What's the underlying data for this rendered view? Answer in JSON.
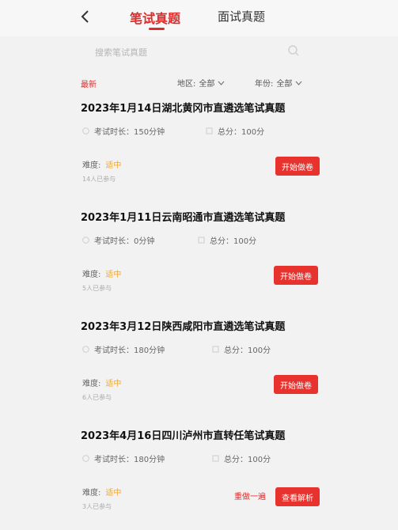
{
  "header": {
    "tabs": [
      {
        "label": "笔试真题"
      },
      {
        "label": "面试真题"
      }
    ]
  },
  "search": {
    "placeholder": "搜索笔试真题"
  },
  "filters": {
    "latest": "最新",
    "region": {
      "label": "地区:",
      "value": "全部"
    },
    "year": {
      "label": "年份:",
      "value": "全部"
    }
  },
  "colors": {
    "accent": "#e02b2b",
    "difficulty": "#f5a623"
  },
  "exams": [
    {
      "title": "2023年1月14日湖北黄冈市直遴选笔试真题",
      "duration": "考试时长：150分钟",
      "score": "总分：100分",
      "difficulty_label": "难度:",
      "difficulty_value": "适中",
      "participants": "14人已参与",
      "primary_button": "开始做卷"
    },
    {
      "title": "2023年1月11日云南昭通市直遴选笔试真题",
      "duration": "考试时长：0分钟",
      "score": "总分：100分",
      "difficulty_label": "难度:",
      "difficulty_value": "适中",
      "participants": "5人已参与",
      "primary_button": "开始做卷"
    },
    {
      "title": "2023年3月12日陕西咸阳市直遴选笔试真题",
      "duration": "考试时长：180分钟",
      "score": "总分：100分",
      "difficulty_label": "难度:",
      "difficulty_value": "适中",
      "participants": "6人已参与",
      "primary_button": "开始做卷"
    },
    {
      "title": "2023年4月16日四川泸州市直转任笔试真题",
      "duration": "考试时长：180分钟",
      "score": "总分：100分",
      "difficulty_label": "难度:",
      "difficulty_value": "适中",
      "participants": "3人已参与",
      "secondary_button": "重做一遍",
      "primary_button": "查看解析"
    }
  ]
}
